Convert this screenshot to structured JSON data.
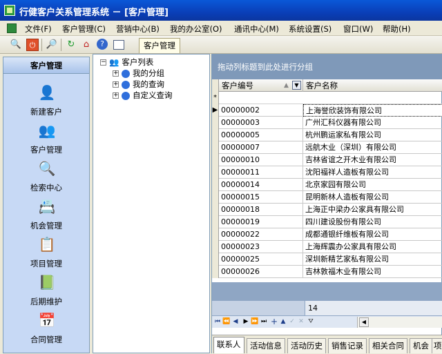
{
  "titlebar": {
    "title": "行健客户关系管理系统 － [客户管理]"
  },
  "menu": [
    "文件(F)",
    "客户管理(C)",
    "营销中心(B)",
    "我的办公室(O)",
    "通讯中心(M)",
    "系统设置(S)",
    "窗口(W)",
    "帮助(H)"
  ],
  "toolbar": {
    "doc_tab": "客户管理"
  },
  "sidebar": {
    "title": "客户管理",
    "items": [
      "新建客户",
      "客户管理",
      "检索中心",
      "机会管理",
      "项目管理",
      "后期维护",
      "合同管理"
    ]
  },
  "tree": {
    "root": "客户列表",
    "children": [
      "我的分组",
      "我的查询",
      "自定义查询"
    ]
  },
  "grid": {
    "group_hint": "拖动列标题到此处进行分组",
    "columns": [
      "客户编号",
      "客户名称"
    ],
    "new_row_marker": "*",
    "rows": [
      [
        "00000002",
        "上海誉欣装饰有限公司"
      ],
      [
        "00000003",
        "广州汇科仪器有限公司"
      ],
      [
        "00000005",
        "杭州鹏运家私有限公司"
      ],
      [
        "00000007",
        "远航木业（深圳）有限公司"
      ],
      [
        "00000010",
        "吉林省谊之开木业有限公司"
      ],
      [
        "00000011",
        "沈阳福祥人造板有限公司"
      ],
      [
        "00000014",
        "北京家园有限公司"
      ],
      [
        "00000015",
        "昆明新林人造板有限公司"
      ],
      [
        "00000018",
        "上海正中梁办公家具有限公司"
      ],
      [
        "00000019",
        "四川建设股份有限公司"
      ],
      [
        "00000022",
        "成都通银纤维板有限公司"
      ],
      [
        "00000023",
        "上海辉震办公家具有限公司"
      ],
      [
        "00000025",
        "深圳新精艺家私有限公司"
      ],
      [
        "00000026",
        "吉林敦福木业有限公司"
      ]
    ],
    "record_count": "14"
  },
  "detail_tabs": [
    "联系人",
    "活动信息",
    "活动历史",
    "销售记录",
    "相关合同",
    "机会",
    "项"
  ]
}
